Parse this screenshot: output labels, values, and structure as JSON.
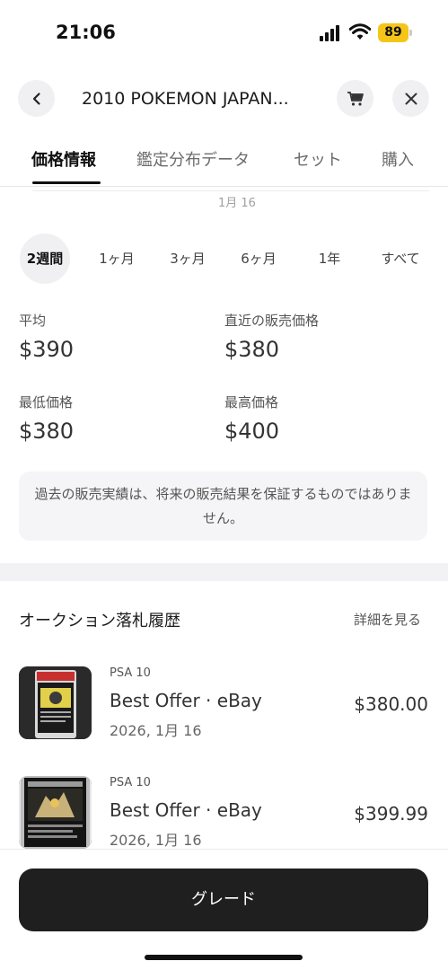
{
  "status_bar": {
    "time": "21:06",
    "battery": "89"
  },
  "header": {
    "title": "2010 POKEMON JAPAN..."
  },
  "tabs": [
    {
      "label": "価格情報"
    },
    {
      "label": "鑑定分布データ"
    },
    {
      "label": "セット"
    },
    {
      "label": "購入"
    }
  ],
  "chart": {
    "date_label": "1月 16"
  },
  "periods": [
    {
      "label": "2週間"
    },
    {
      "label": "1ヶ月"
    },
    {
      "label": "3ヶ月"
    },
    {
      "label": "6ヶ月"
    },
    {
      "label": "1年"
    },
    {
      "label": "すべて"
    }
  ],
  "selected_period": "2週間",
  "stats": {
    "average": {
      "label": "平均",
      "value": "$390"
    },
    "recent": {
      "label": "直近の販売価格",
      "value": "$380"
    },
    "lowest": {
      "label": "最低価格",
      "value": "$380"
    },
    "highest": {
      "label": "最高価格",
      "value": "$400"
    }
  },
  "disclaimer": "過去の販売実績は、将来の販売結果を保証するものではありません。",
  "auction": {
    "title": "オークション落札履歴",
    "link": "詳細を見る",
    "items": [
      {
        "grade": "PSA 10",
        "title": "Best Offer · eBay",
        "date": "2026, 1月 16",
        "price": "$380.00"
      },
      {
        "grade": "PSA 10",
        "title": "Best Offer · eBay",
        "date": "2026, 1月 16",
        "price": "$399.99"
      }
    ]
  },
  "grade_button": {
    "label": "グレード"
  },
  "colors": {
    "primary_button": "#1f1f1f",
    "battery": "#f5c518"
  }
}
